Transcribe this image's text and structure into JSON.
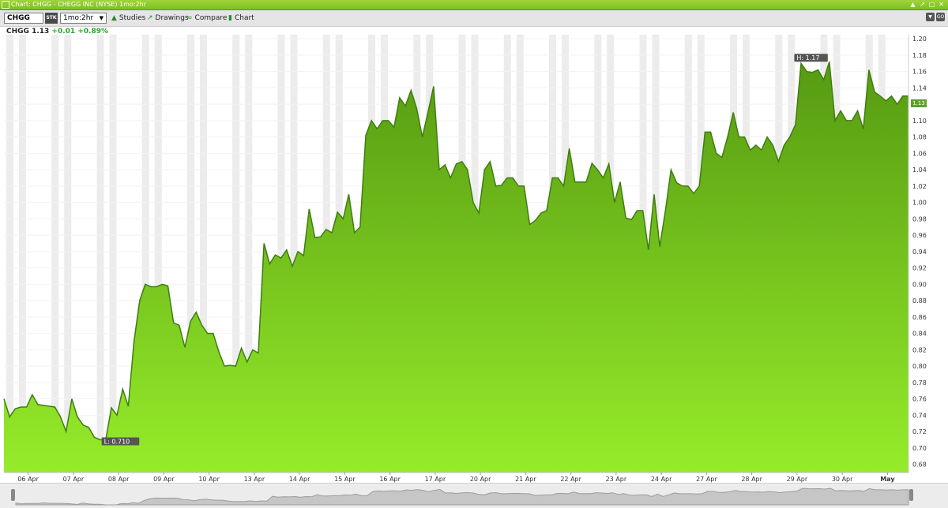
{
  "window": {
    "title": "Chart: CHGG - CHEGG INC (NYSE) 1mo:2hr",
    "controls": [
      "pin-icon",
      "popout-icon",
      "restore-icon",
      "close-icon"
    ]
  },
  "toolbar": {
    "symbol": "CHGG",
    "security_type": "STK",
    "period": "1mo:2hr",
    "buttons": [
      {
        "name": "studies",
        "label": "Studies",
        "icon": "graduation-cap-icon"
      },
      {
        "name": "drawings",
        "label": "Drawings",
        "icon": "pen-cursor-icon"
      },
      {
        "name": "compare",
        "label": "Compare",
        "icon": "compare-icon"
      },
      {
        "name": "chart",
        "label": "Chart",
        "icon": "candlestick-icon"
      }
    ],
    "right_buttons": [
      "dropdown-icon",
      "go-icon"
    ],
    "go_label": "GO"
  },
  "quote": {
    "symbol": "CHGG",
    "last": "1.13",
    "change": "+0.01",
    "change_pct": "+0.89%"
  },
  "last_price_tag": "1.13",
  "colors": {
    "accent": "#7bbf1f",
    "area_top": "#569a12",
    "area_bottom": "#96ec2a",
    "line": "#3f7d10",
    "stripe": "#ececec",
    "positive": "#2aa52a"
  },
  "chart_data": {
    "type": "area",
    "title": "",
    "xlabel": "",
    "ylabel": "",
    "x_ticks": [
      "06 Apr",
      "07 Apr",
      "08 Apr",
      "09 Apr",
      "10 Apr",
      "13 Apr",
      "14 Apr",
      "15 Apr",
      "16 Apr",
      "17 Apr",
      "20 Apr",
      "21 Apr",
      "22 Apr",
      "23 Apr",
      "24 Apr",
      "27 Apr",
      "28 Apr",
      "29 Apr",
      "30 Apr",
      "May"
    ],
    "y_ticks": [
      "0.68",
      "0.70",
      "0.72",
      "0.74",
      "0.76",
      "0.78",
      "0.80",
      "0.82",
      "0.84",
      "0.86",
      "0.88",
      "0.90",
      "0.92",
      "0.94",
      "0.96",
      "0.98",
      "1.00",
      "1.02",
      "1.04",
      "1.06",
      "1.08",
      "1.10",
      "1.12",
      "1.14",
      "1.16",
      "1.18",
      "1.20"
    ],
    "ylim": [
      0.67,
      1.205
    ],
    "grid": true,
    "series": [
      {
        "values": [
          0.76,
          0.738,
          0.748,
          0.75,
          0.75,
          0.765,
          0.753,
          0.752,
          0.751,
          0.75,
          0.738,
          0.72,
          0.76,
          0.738,
          0.728,
          0.725,
          0.713,
          0.71,
          0.71,
          0.749,
          0.74,
          0.772,
          0.751,
          0.83,
          0.88,
          0.9,
          0.897,
          0.897,
          0.9,
          0.898,
          0.853,
          0.85,
          0.823,
          0.855,
          0.866,
          0.85,
          0.84,
          0.84,
          0.818,
          0.8,
          0.801,
          0.8,
          0.822,
          0.805,
          0.82,
          0.816,
          0.95,
          0.925,
          0.936,
          0.932,
          0.942,
          0.922,
          0.94,
          0.935,
          0.992,
          0.957,
          0.958,
          0.967,
          0.963,
          0.988,
          0.98,
          1.01,
          0.963,
          0.97,
          1.082,
          1.1,
          1.09,
          1.1,
          1.1,
          1.092,
          1.128,
          1.118,
          1.137,
          1.115,
          1.08,
          1.11,
          1.142,
          1.04,
          1.046,
          1.03,
          1.047,
          1.05,
          1.04,
          1.0,
          0.987,
          1.04,
          1.05,
          1.02,
          1.021,
          1.03,
          1.03,
          1.02,
          1.02,
          0.973,
          0.978,
          0.987,
          0.99,
          1.03,
          1.03,
          1.02,
          1.066,
          1.025,
          1.025,
          1.025,
          1.048,
          1.04,
          1.03,
          1.047,
          1.0,
          1.025,
          0.981,
          0.979,
          0.99,
          0.99,
          0.942,
          1.01,
          0.946,
          0.99,
          1.04,
          1.024,
          1.02,
          1.02,
          1.011,
          1.02,
          1.086,
          1.086,
          1.06,
          1.055,
          1.08,
          1.11,
          1.08,
          1.08,
          1.064,
          1.07,
          1.064,
          1.08,
          1.07,
          1.05,
          1.07,
          1.08,
          1.095,
          1.17,
          1.16,
          1.159,
          1.162,
          1.15,
          1.172,
          1.1,
          1.112,
          1.1,
          1.1,
          1.112,
          1.09,
          1.162,
          1.135,
          1.13,
          1.124,
          1.13,
          1.12,
          1.13,
          1.13
        ]
      }
    ],
    "annotations": [
      {
        "label": "L: 0.710"
      },
      {
        "label": "H: 1.17"
      }
    ]
  }
}
